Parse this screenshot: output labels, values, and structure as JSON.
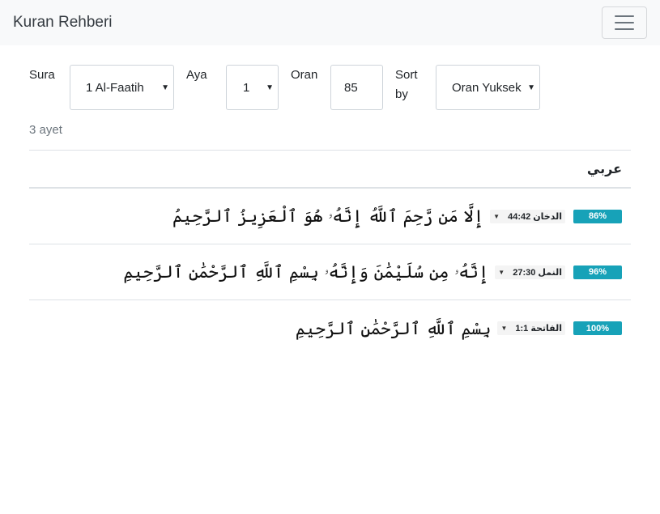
{
  "navbar": {
    "brand": "Kuran Rehberi"
  },
  "form": {
    "sura_label": "Sura",
    "sura_value": "1 Al-Faatih",
    "aya_label": "Aya",
    "aya_value": "1",
    "oran_label": "Oran",
    "oran_value": "85",
    "sort_label_line1": "Sort",
    "sort_label_line2": "by",
    "sort_value": "Oran Yuksek"
  },
  "result_count": "3 ayet",
  "table": {
    "header": "عربي",
    "rows": [
      {
        "text": "إِلَّا مَن رَّحِمَ ٱللَّهُ إِنَّهُۥ هُوَ ٱلْعَزِيزُ ٱلرَّحِيمُ",
        "ref": "الدخان 44:42",
        "percent": "86%"
      },
      {
        "text": "إِنَّهُۥ مِن سُلَيْمَٰنَ وَإِنَّهُۥ بِسْمِ ٱللَّهِ ٱلرَّحْمَٰنِ ٱلرَّحِيمِ",
        "ref": "النمل 27:30",
        "percent": "96%"
      },
      {
        "text": "بِسْمِ ٱللَّهِ ٱلرَّحْمَٰنِ ٱلرَّحِيمِ",
        "ref": "الفاتحة 1:1",
        "percent": "100%"
      }
    ]
  },
  "colors": {
    "badge": "#17a2b8",
    "navbar_bg": "#f8f9fa"
  },
  "icons": {
    "menu": "hamburger-icon",
    "caret": "caret-down-icon"
  }
}
